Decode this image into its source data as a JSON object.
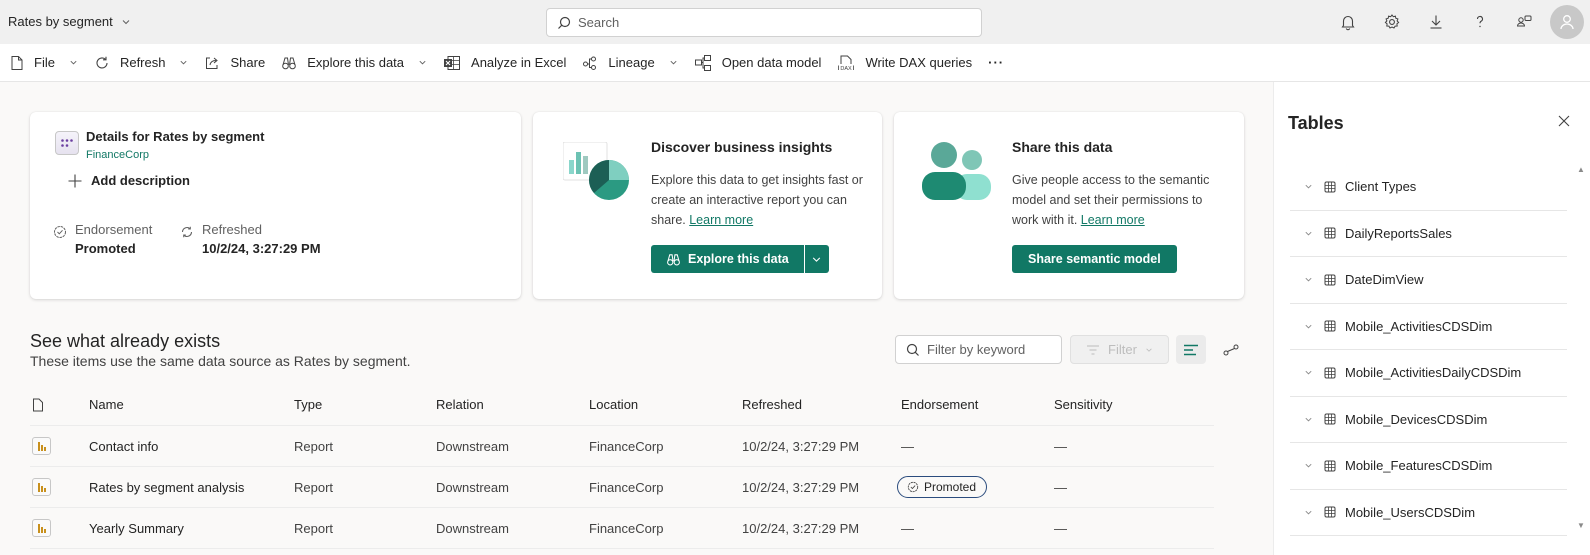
{
  "topbar": {
    "title": "Rates by segment",
    "search_placeholder": "Search",
    "icons": [
      "bell-icon",
      "gear-icon",
      "download-icon",
      "help-icon",
      "feedback-icon",
      "avatar"
    ]
  },
  "toolbar": {
    "items": [
      {
        "label": "File",
        "icon": "file-icon",
        "dropdown": true
      },
      {
        "label": "Refresh",
        "icon": "refresh-icon",
        "dropdown": true
      },
      {
        "label": "Share",
        "icon": "share-icon",
        "dropdown": false
      },
      {
        "label": "Explore this data",
        "icon": "binoculars-icon",
        "dropdown": true
      },
      {
        "label": "Analyze in Excel",
        "icon": "excel-icon",
        "dropdown": false
      },
      {
        "label": "Lineage",
        "icon": "lineage-icon",
        "dropdown": true
      },
      {
        "label": "Open data model",
        "icon": "data-model-icon",
        "dropdown": false
      },
      {
        "label": "Write DAX queries",
        "icon": "dax-icon",
        "dropdown": false
      }
    ],
    "more_label": "···"
  },
  "details": {
    "title": "Details for Rates by segment",
    "workspace": "FinanceCorp",
    "add_description": "Add description",
    "endorsement_label": "Endorsement",
    "endorsement_value": "Promoted",
    "refreshed_label": "Refreshed",
    "refreshed_value": "10/2/24, 3:27:29 PM"
  },
  "discover": {
    "title": "Discover business insights",
    "description": "Explore this data to get insights fast or create an interactive report you can share.",
    "learn_more": "Learn more",
    "button_label": "Explore this data"
  },
  "share": {
    "title": "Share this data",
    "description": "Give people access to the semantic model and set their permissions to work with it.",
    "learn_more": "Learn more",
    "button_label": "Share semantic model"
  },
  "existing": {
    "title": "See what already exists",
    "subtitle": "These items use the same data source as Rates by segment.",
    "filter_placeholder": "Filter by keyword",
    "filter_label": "Filter",
    "columns": [
      "Name",
      "Type",
      "Relation",
      "Location",
      "Refreshed",
      "Endorsement",
      "Sensitivity"
    ],
    "rows": [
      {
        "name": "Contact info",
        "type": "Report",
        "relation": "Downstream",
        "location": "FinanceCorp",
        "refreshed": "10/2/24, 3:27:29 PM",
        "endorsement": "—",
        "sensitivity": "—"
      },
      {
        "name": "Rates by segment analysis",
        "type": "Report",
        "relation": "Downstream",
        "location": "FinanceCorp",
        "refreshed": "10/2/24, 3:27:29 PM",
        "endorsement": "Promoted",
        "sensitivity": "—"
      },
      {
        "name": "Yearly Summary",
        "type": "Report",
        "relation": "Downstream",
        "location": "FinanceCorp",
        "refreshed": "10/2/24, 3:27:29 PM",
        "endorsement": "—",
        "sensitivity": "—"
      }
    ]
  },
  "tables_panel": {
    "title": "Tables",
    "items": [
      "Client Types",
      "DailyReportsSales",
      "DateDimView",
      "Mobile_ActivitiesCDSDim",
      "Mobile_ActivitiesDailyCDSDim",
      "Mobile_DevicesCDSDim",
      "Mobile_FeaturesCDSDim",
      "Mobile_UsersCDSDim"
    ]
  },
  "colors": {
    "brand": "#117865",
    "link": "#117865",
    "badge_border": "#2b4c7e",
    "report_icon": "#c8901d"
  }
}
